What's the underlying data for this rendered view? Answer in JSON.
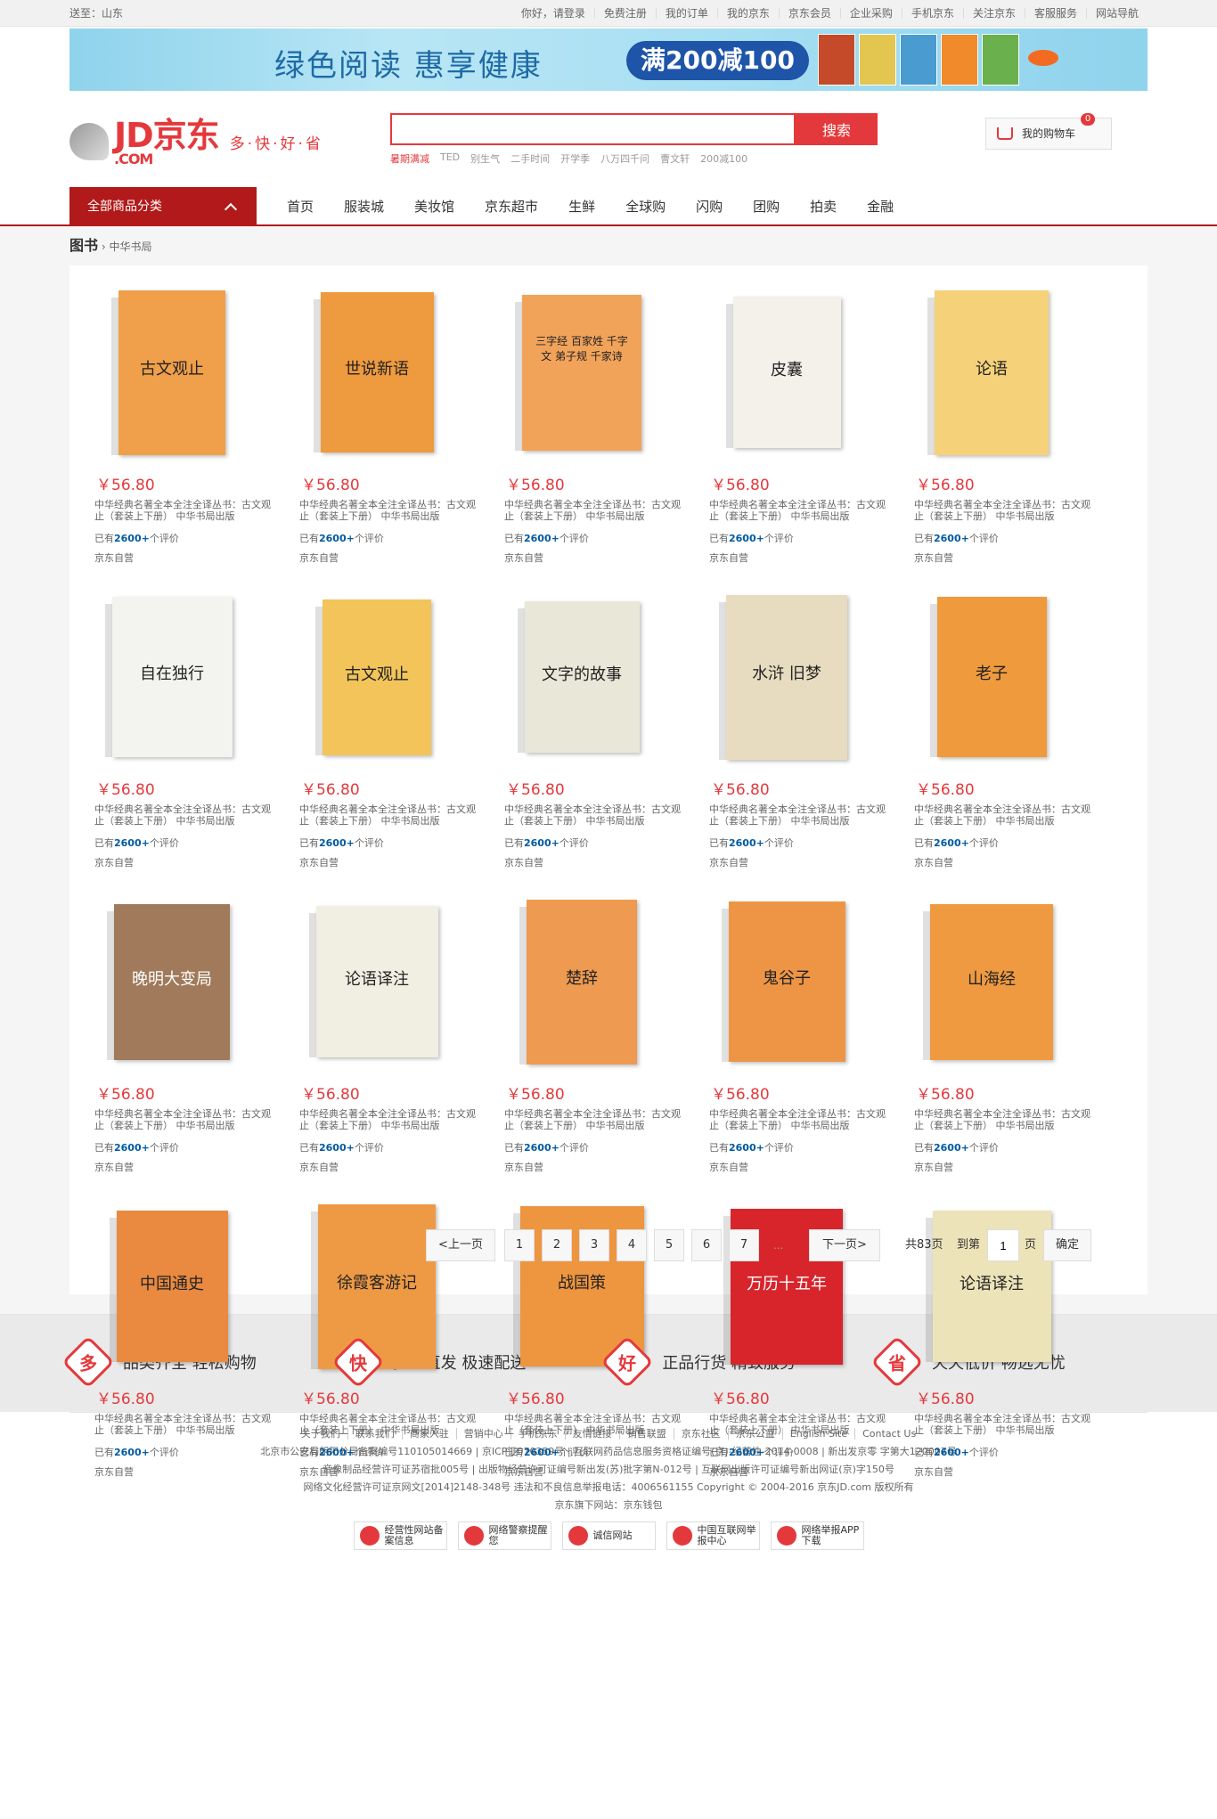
{
  "topbar": {
    "location": "送至：山东",
    "links": [
      "你好，请登录",
      "免费注册",
      "我的订单",
      "我的京东",
      "京东会员",
      "企业采购",
      "手机京东",
      "关注京东",
      "客服服务",
      "网站导航"
    ]
  },
  "banner": {
    "text": "绿色阅读  惠享健康",
    "promo": "满200减100"
  },
  "header": {
    "logo_text": "JD京东",
    "logo_domain": ".COM",
    "slogan": "多·快·好·省",
    "search_button": "搜索",
    "hot_words": [
      "暑期满减",
      "TED",
      "别生气",
      "二手时间",
      "开学季",
      "八万四千问",
      "曹文轩",
      "200减100"
    ],
    "cart_label": "我的购物车",
    "cart_count": "0"
  },
  "nav": {
    "all_categories": "全部商品分类",
    "items": [
      "首页",
      "服装城",
      "美妆馆",
      "京东超市",
      "生鲜",
      "全球购",
      "闪购",
      "团购",
      "拍卖",
      "金融"
    ]
  },
  "breadcrumb": {
    "root": "图书",
    "sep": "›",
    "current": "中华书局"
  },
  "product_template": {
    "price": "￥56.80",
    "name": "中华经典名著全本全注全译丛书：古文观止（套装上下册） 中华书局出版",
    "reviews_prefix": "已有",
    "reviews_count": "2600+",
    "reviews_suffix": "个评价",
    "seller": "京东自营"
  },
  "products": [
    {
      "cover_title": "古文观止",
      "cover_color": "#f0a04a"
    },
    {
      "cover_title": "世说新语",
      "cover_color": "#ee9a3e"
    },
    {
      "cover_title": "三字经 百家姓 千字文 弟子规 千家诗",
      "cover_color": "#f2a35a"
    },
    {
      "cover_title": "皮囊",
      "cover_color": "#f4f1ea"
    },
    {
      "cover_title": "论语",
      "cover_color": "#f5d27a"
    },
    {
      "cover_title": "自在独行",
      "cover_color": "#f3f3f0"
    },
    {
      "cover_title": "古文观止",
      "cover_color": "#f2c45a"
    },
    {
      "cover_title": "文字的故事",
      "cover_color": "#e9e7d8"
    },
    {
      "cover_title": "水浒 旧梦",
      "cover_color": "#e8dcc0"
    },
    {
      "cover_title": "老子",
      "cover_color": "#ef9a3c"
    },
    {
      "cover_title": "晚明大变局",
      "cover_color": "#a07a5a"
    },
    {
      "cover_title": "论语译注",
      "cover_color": "#f1efe2"
    },
    {
      "cover_title": "楚辞",
      "cover_color": "#ee9a50"
    },
    {
      "cover_title": "鬼谷子",
      "cover_color": "#ee9545"
    },
    {
      "cover_title": "山海经",
      "cover_color": "#ef9a40"
    },
    {
      "cover_title": "中国通史",
      "cover_color": "#e98a40"
    },
    {
      "cover_title": "徐霞客游记",
      "cover_color": "#ee9a45"
    },
    {
      "cover_title": "战国策",
      "cover_color": "#ee9540"
    },
    {
      "cover_title": "万历十五年",
      "cover_color": "#d8252b"
    },
    {
      "cover_title": "论语译注",
      "cover_color": "#ece3b8"
    }
  ],
  "pager": {
    "prev": "<上一页",
    "pages": [
      "1",
      "2",
      "3",
      "4",
      "5",
      "6",
      "7"
    ],
    "ellipsis": "...",
    "next": "下一页>",
    "total": "共83页",
    "goto_label": "到第",
    "goto_value": "1",
    "page_unit": "页",
    "confirm": "确定"
  },
  "service": [
    {
      "icon": "多",
      "label": "品类齐全  轻松购物"
    },
    {
      "icon": "快",
      "label": "多仓直发  极速配送"
    },
    {
      "icon": "好",
      "label": "正品行货  精致服务"
    },
    {
      "icon": "省",
      "label": "天天低价  畅选无忧"
    }
  ],
  "footer": {
    "links": [
      "关于我们",
      "联系我们",
      "商家入驻",
      "营销中心",
      "手机京东",
      "友情链接",
      "销售联盟",
      "京东社区",
      "京东公益",
      "English Site",
      "Contact Us"
    ],
    "line1": "北京市公安局朝阳分局备案编号110105014669  |  京ICP证070359号  |  互联网药品信息服务资格证编号(京)-经营性-2014-0008  |  新出发京零 字第大120007号",
    "line2": "音像制品经营许可证苏宿批005号  |  出版物经营许可证编号新出发(苏)批字第N-012号  |  互联网出版许可证编号新出网证(京)字150号",
    "line3": "网络文化经营许可证京网文[2014]2148-348号   违法和不良信息举报电话：4006561155  Copyright © 2004-2016  京东JD.com 版权所有",
    "line4": "京东旗下网站：京东钱包",
    "badges": [
      "经营性网站备案信息",
      "网络警察提醒您",
      "诚信网站",
      "中国互联网举报中心",
      "网络举报APP下载"
    ]
  }
}
